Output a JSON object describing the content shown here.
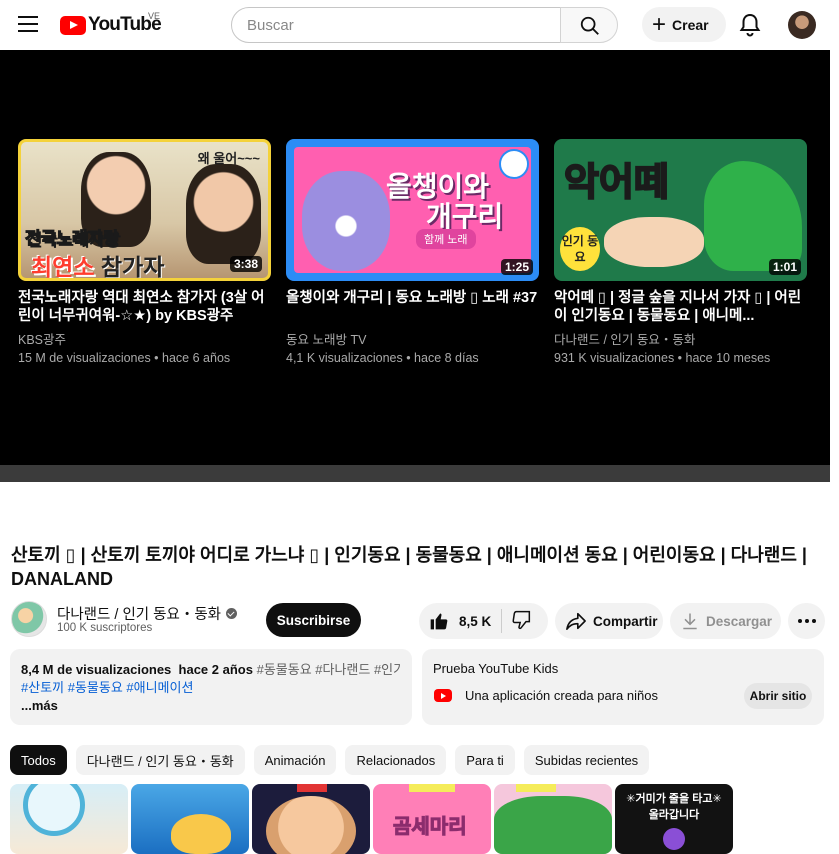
{
  "header": {
    "logo_text": "YouTube",
    "country_code": "VE",
    "search_placeholder": "Buscar",
    "create_label": "Crear"
  },
  "end_screen": [
    {
      "title": "전국노래자랑 역대 최연소 참가자 (3살 어린이 너무귀여워-☆★) by KBS광주",
      "channel": "KBS광주",
      "meta": "15 M de visualizaciones • hace 6 años",
      "duration": "3:38",
      "thumb_text_top": "왜 울어~~~",
      "thumb_text_mid": "전국노래자랑",
      "thumb_text_bottom_red": "최연소",
      "thumb_text_bottom": " 참가자"
    },
    {
      "title": "올챙이와 개구리 | 동요 노래방 ▯ 노래 #37",
      "channel": "동요 노래방 TV",
      "meta": "4,1 K visualizaciones • hace 8 días",
      "duration": "1:25",
      "thumb_text_1": "올챙이와",
      "thumb_text_2": "개구리",
      "thumb_text_3": "함께 노래"
    },
    {
      "title": "악어떼 ▯ | 정글 숲을 지나서 가자 ▯ | 어린이 인기동요 | 동물동요 | 애니메...",
      "channel": "다나랜드 / 인기 동요・동화",
      "meta": "931 K visualizaciones • hace 10 meses",
      "duration": "1:01",
      "thumb_text_1": "악어떼",
      "thumb_tag": "인기 동요"
    }
  ],
  "video": {
    "title": "산토끼 ▯ | 산토끼 토끼야 어디로 가느냐 ▯ | 인기동요 | 동물동요 | 애니메이션 동요 | 어린이동요 | 다나랜드 | DANALAND",
    "channel_name": "다나랜드 / 인기 동요・동화",
    "subscribers": "100 K suscriptores",
    "subscribe_label": "Suscribirse",
    "likes": "8,5 K",
    "share_label": "Compartir",
    "download_label": "Descargar"
  },
  "description": {
    "views": "8,4 M de visualizaciones",
    "date": "hace 2 años",
    "inline_tags": "#동물동요 #다나랜드 #인기",
    "tags": "#산토끼 #동물동요 #애니메이션",
    "more": "...más"
  },
  "kids_promo": {
    "title": "Prueba YouTube Kids",
    "subtitle": "Una aplicación creada para niños",
    "button": "Abrir sitio"
  },
  "chips": [
    "Todos",
    "다나랜드 / 인기 동요・동화",
    "Animación",
    "Relacionados",
    "Para ti",
    "Subidas recientes"
  ],
  "recs": {
    "rec4_text": "곰세마리",
    "rec6_line1": "✳거미가 줄을 타고✳",
    "rec6_line2": "올라갑니다"
  }
}
